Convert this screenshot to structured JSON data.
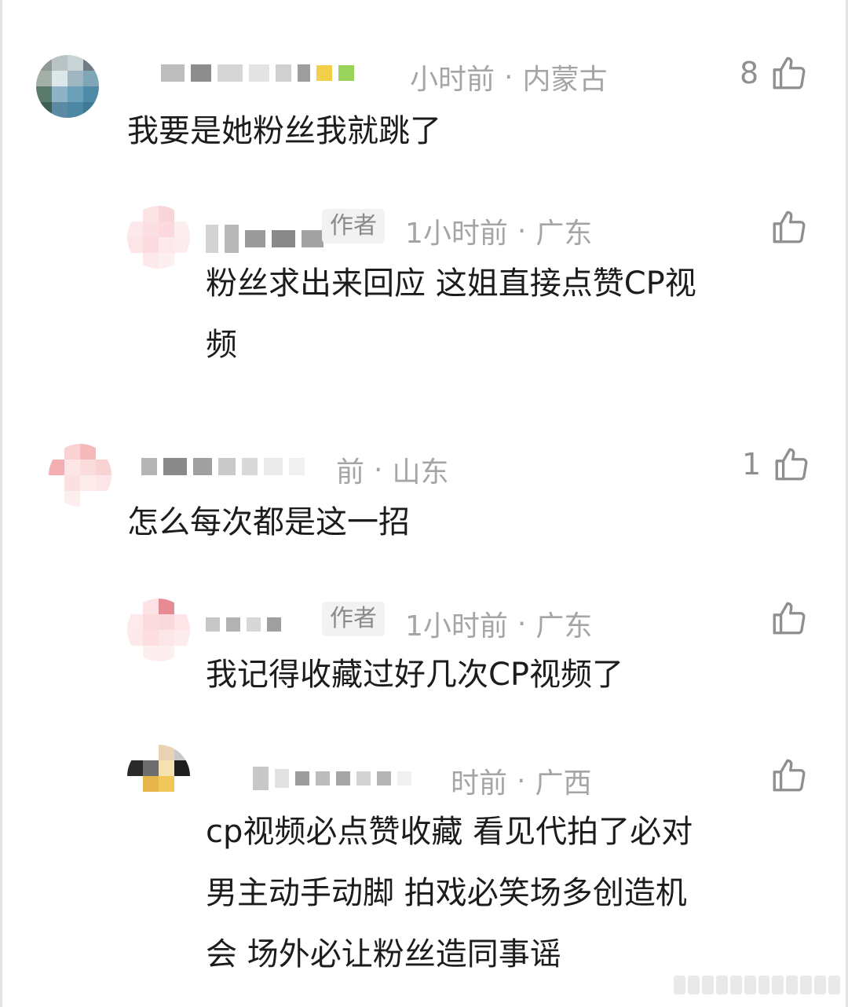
{
  "comments": [
    {
      "meta_time": "小时前",
      "meta_location": "内蒙古",
      "likes": "8",
      "text": "我要是她粉丝我就跳了",
      "reply": {
        "author_tag": "作者",
        "meta_time": "1小时前",
        "meta_location": "广东",
        "likes": "",
        "text_lines": [
          "粉丝求出来回应  这姐直接点赞CP视",
          "频"
        ]
      }
    },
    {
      "meta_time": "前",
      "meta_location": "山东",
      "likes": "1",
      "text": "怎么每次都是这一招",
      "reply": {
        "author_tag": "作者",
        "meta_time": "1小时前",
        "meta_location": "广东",
        "likes": "",
        "text_lines": [
          "我记得收藏过好几次CP视频了"
        ]
      },
      "reply2": {
        "meta_time": "时前",
        "meta_location": "广西",
        "likes": "",
        "text_lines": [
          "cp视频必点赞收藏 看见代拍了必对",
          "男主动手动脚 拍戏必笑场多创造机",
          "会 场外必让粉丝造同事谣"
        ]
      }
    }
  ],
  "colors": {
    "meta_gray": "#a5a5a5",
    "text": "#1c1c1c",
    "icon_gray": "#8f8f8f"
  },
  "icons": {
    "like": "thumbs-up-icon"
  }
}
